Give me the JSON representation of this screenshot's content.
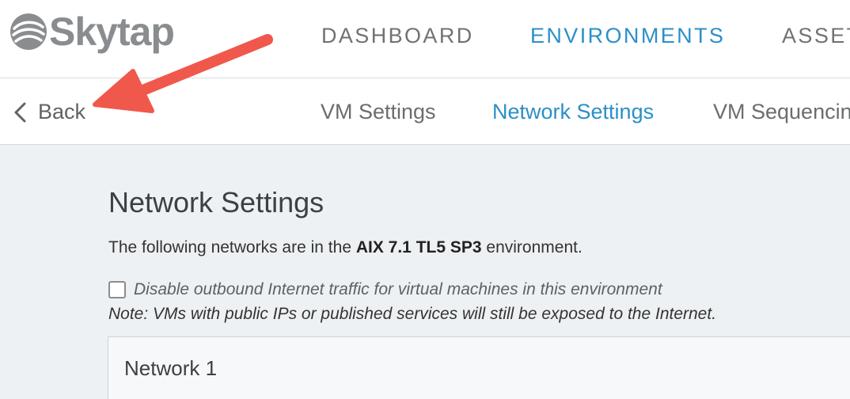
{
  "brand": {
    "name": "Skytap",
    "logo_color": "#8a8d90"
  },
  "main_nav": {
    "items": [
      {
        "label": "DASHBOARD",
        "active": false
      },
      {
        "label": "ENVIRONMENTS",
        "active": true
      },
      {
        "label": "ASSETS",
        "active": false
      }
    ]
  },
  "sub_nav": {
    "back_label": "Back",
    "tabs": [
      {
        "label": "VM Settings",
        "active": false
      },
      {
        "label": "Network Settings",
        "active": true
      },
      {
        "label": "VM Sequencing",
        "active": false
      }
    ]
  },
  "content": {
    "title": "Network Settings",
    "intro_prefix": "The following networks are in the ",
    "environment_name": "AIX 7.1 TL5 SP3",
    "intro_suffix": " environment.",
    "checkbox_label": "Disable outbound Internet traffic for virtual machines in this environment",
    "checkbox_checked": false,
    "note": "Note: VMs with public IPs or published services will still be exposed to the Internet.",
    "networks": [
      {
        "name": "Network 1"
      }
    ]
  },
  "colors": {
    "accent": "#2b8fc9",
    "annotation_arrow": "#f0584c",
    "page_background": "#eef1f3"
  },
  "icons": {
    "back": "chevron-left-icon",
    "annotation": "arrow-icon"
  }
}
